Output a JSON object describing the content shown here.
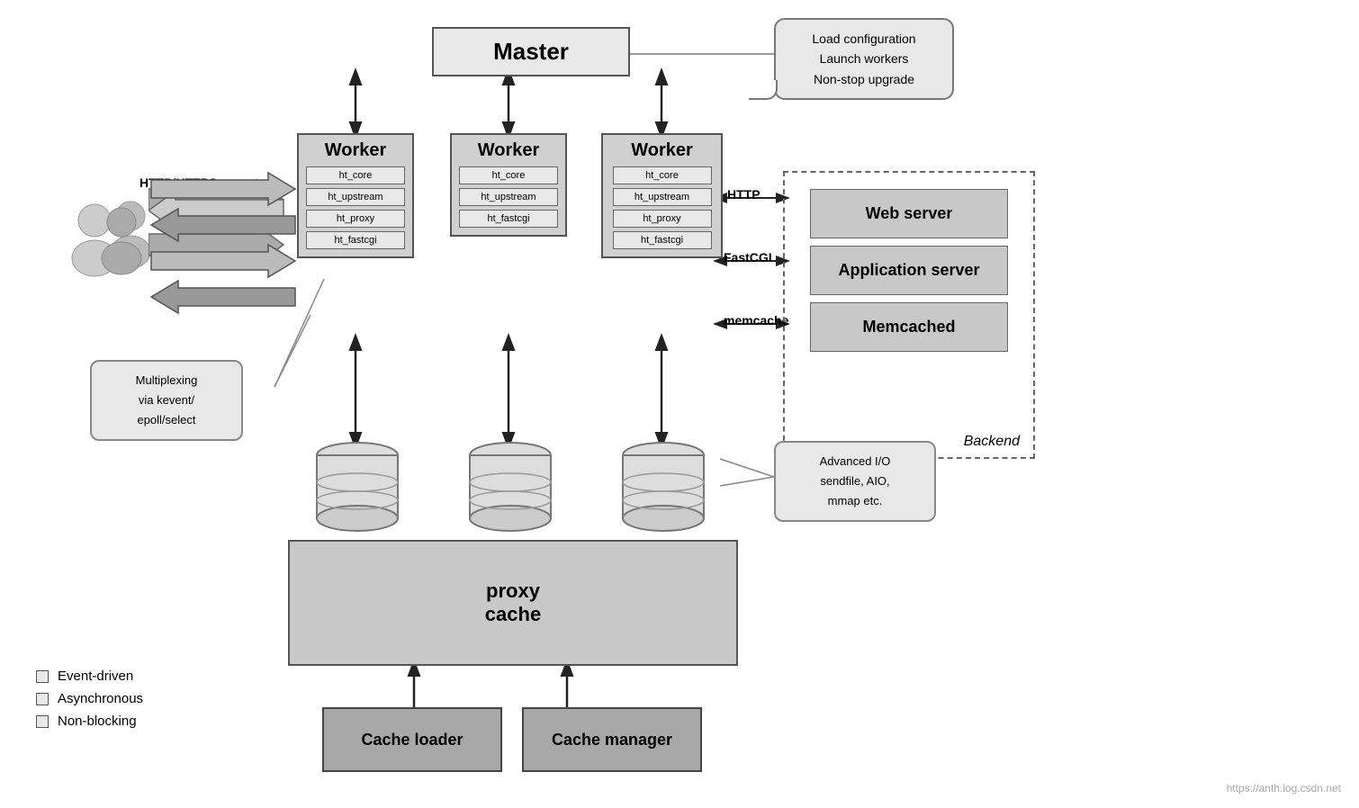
{
  "master": {
    "label": "Master"
  },
  "speech_bubble": {
    "line1": "Load configuration",
    "line2": "Launch workers",
    "line3": "Non-stop upgrade"
  },
  "workers": [
    {
      "title": "Worker",
      "modules": [
        "ht_core",
        "ht_upstream",
        "ht_proxy",
        "ht_fastcgi"
      ]
    },
    {
      "title": "Worker",
      "modules": [
        "ht_core",
        "ht_upstream",
        "ht_fastcgi"
      ]
    },
    {
      "title": "Worker",
      "modules": [
        "ht_core",
        "ht_upstream",
        "ht_proxy",
        "ht_fastcgi"
      ]
    }
  ],
  "http_label": "HTTP/HTTPS",
  "protocols": {
    "http": "HTTP",
    "fastcgi": "FastCGI",
    "memcache": "memcache"
  },
  "backend": {
    "title": "Backend",
    "items": [
      "Web server",
      "Application server",
      "Memcached"
    ]
  },
  "proxy_cache": {
    "label": "proxy\ncache"
  },
  "cache_loader": {
    "label": "Cache loader"
  },
  "cache_manager": {
    "label": "Cache manager"
  },
  "callout_multiplexing": {
    "text": "Multiplexing\nvia kevent/\nepoll/select"
  },
  "callout_advanced_io": {
    "text": "Advanced I/O\nsendfile, AIO,\nmmap etc."
  },
  "legend": {
    "items": [
      "Event-driven",
      "Asynchronous",
      "Non-blocking"
    ]
  },
  "watermark": "https://anth.log.csdn.net"
}
